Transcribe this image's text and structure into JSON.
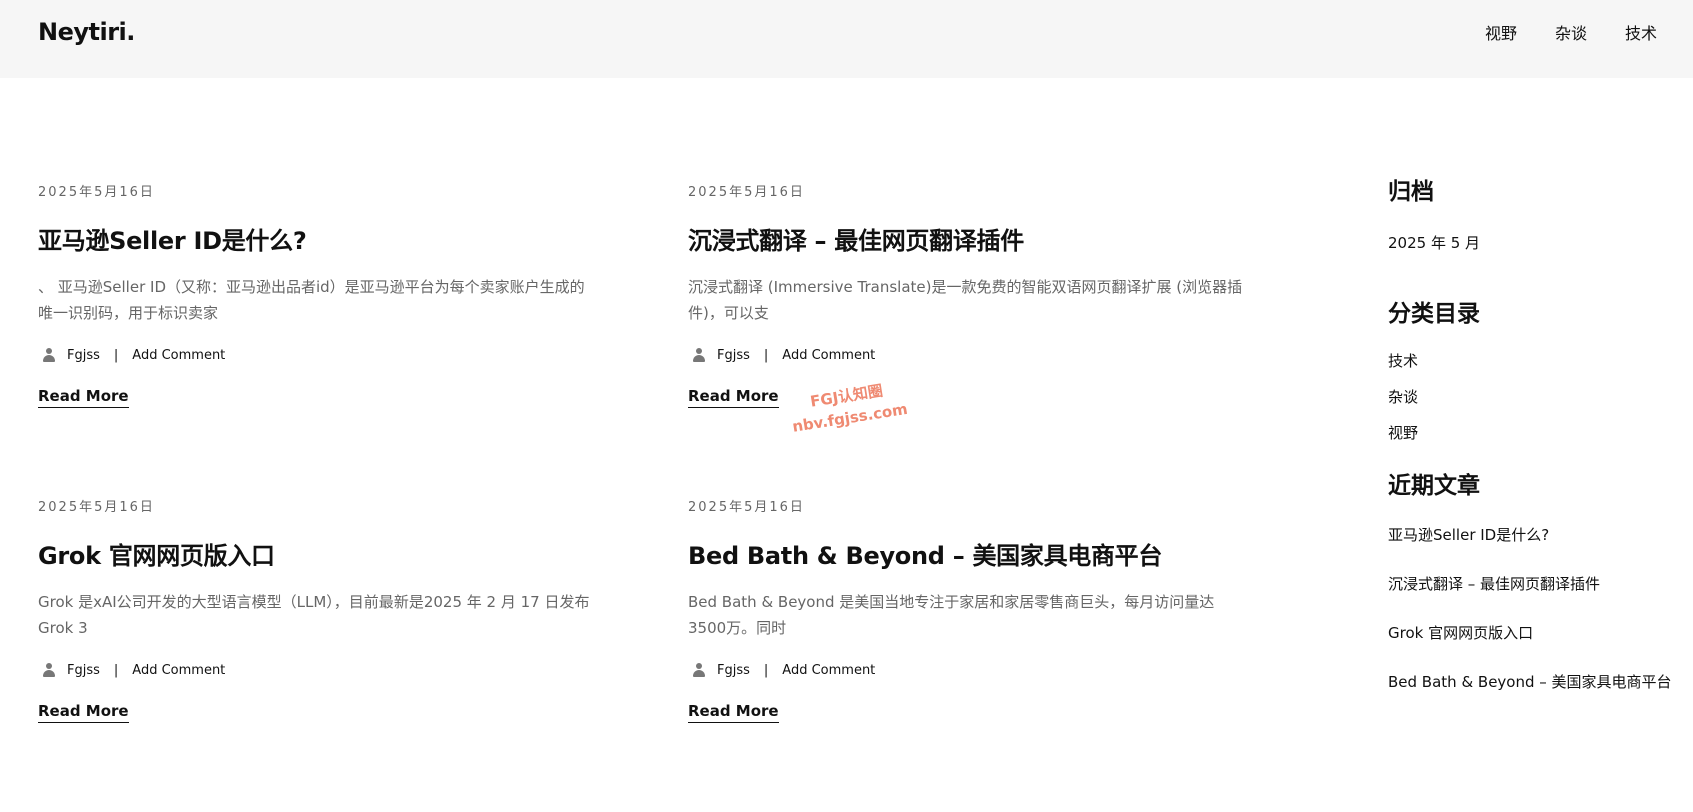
{
  "header": {
    "logo": "Neytiri.",
    "nav": [
      "视野",
      "杂谈",
      "技术"
    ]
  },
  "posts": [
    {
      "date": "2025年5月16日",
      "title": "亚马逊Seller ID是什么?",
      "excerpt": "、 亚马逊Seller ID（又称：亚马逊出品者id）是亚马逊平台为每个卖家账户生成的唯一识别码，用于标识卖家",
      "author": "Fgjss",
      "separator": "|",
      "comment": "Add Comment",
      "read_more": "Read More"
    },
    {
      "date": "2025年5月16日",
      "title": "沉浸式翻译 – 最佳网页翻译插件",
      "excerpt": "沉浸式翻译 (Immersive Translate)是一款免费的智能双语网页翻译扩展 (浏览器插件)，可以支",
      "author": "Fgjss",
      "separator": "|",
      "comment": "Add Comment",
      "read_more": "Read More"
    },
    {
      "date": "2025年5月16日",
      "title": "Grok 官网网页版入口",
      "excerpt": "Grok 是xAI公司开发的大型语言模型（LLM），目前最新是2025 年 2 月 17 日发布Grok 3",
      "author": "Fgjss",
      "separator": "|",
      "comment": "Add Comment",
      "read_more": "Read More"
    },
    {
      "date": "2025年5月16日",
      "title": "Bed Bath & Beyond – 美国家具电商平台",
      "excerpt": "Bed Bath & Beyond 是美国当地专注于家居和家居零售商巨头，每月访问量达3500万。同时",
      "author": "Fgjss",
      "separator": "|",
      "comment": "Add Comment",
      "read_more": "Read More"
    }
  ],
  "sidebar": {
    "archive_title": "归档",
    "archive_items": [
      "2025 年 5 月"
    ],
    "categories_title": "分类目录",
    "categories": [
      "技术",
      "杂谈",
      "视野"
    ],
    "recent_title": "近期文章",
    "recent": [
      "亚马逊Seller ID是什么?",
      "沉浸式翻译 – 最佳网页翻译插件",
      "Grok 官网网页版入口",
      "Bed Bath & Beyond – 美国家具电商平台"
    ]
  },
  "watermark": {
    "line1": "FGJ认知圈",
    "line2": "nbv.fgjss.com"
  },
  "colors": {
    "header_bg": "#f6f6f6",
    "text": "#111111",
    "muted": "#666666",
    "watermark": "#ef8a72"
  }
}
